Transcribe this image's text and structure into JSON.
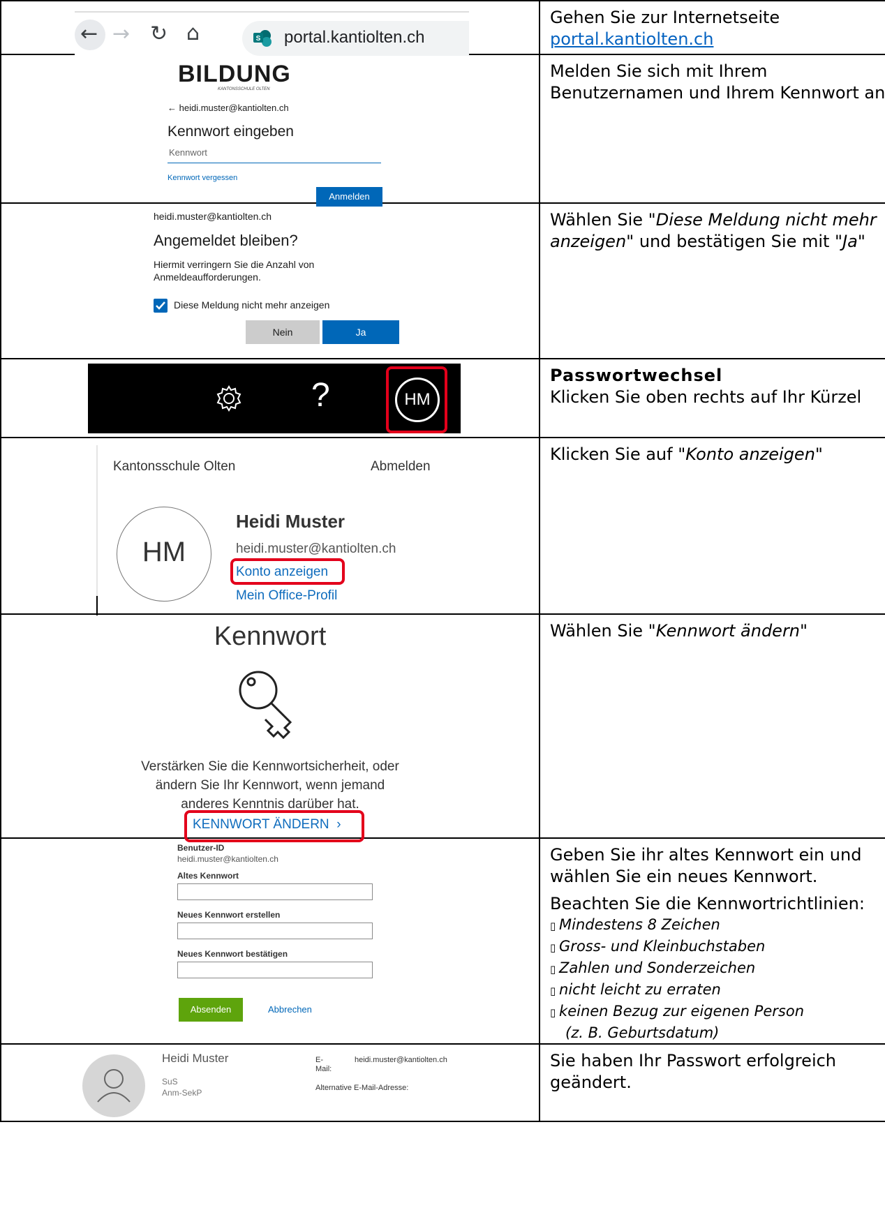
{
  "steps": {
    "s1": {
      "url": "portal.kantiolten.ch",
      "text": "Gehen Sie zur Internetseite",
      "link": "portal.kantiolten.ch"
    },
    "s2": {
      "logo": "BILDUNG",
      "logo_sub": "KANTONSSCHULE OLTEN",
      "back_email": "← heidi.muster@kantiolten.ch",
      "heading": "Kennwort eingeben",
      "field_placeholder": "Kennwort",
      "forgot": "Kennwort vergessen",
      "button": "Anmelden",
      "text": "Melden Sie sich mit Ihrem Benutzernamen und Ihrem Kennwort an."
    },
    "s3": {
      "email": "heidi.muster@kantiolten.ch",
      "heading": "Angemeldet bleiben?",
      "desc1": "Hiermit verringern Sie die Anzahl von",
      "desc2": "Anmeldeaufforderungen.",
      "checkbox": "Diese Meldung nicht mehr anzeigen",
      "no": "Nein",
      "yes": "Ja",
      "text_a": "Wählen Sie \"",
      "text_b": "Diese Meldung nicht mehr anzeigen",
      "text_c": "\" und bestätigen Sie mit \"",
      "text_d": "Ja",
      "text_e": "\""
    },
    "s4": {
      "help": "?",
      "initials": "HM",
      "title": "Passwortwechsel",
      "text": "Klicken Sie oben rechts auf Ihr Kürzel"
    },
    "s5": {
      "org": "Kantonsschule Olten",
      "signout": "Abmelden",
      "initials": "HM",
      "name": "Heidi Muster",
      "email": "heidi.muster@kantiolten.ch",
      "account": "Konto anzeigen",
      "office": "Mein Office-Profil",
      "text_a": "Klicken Sie auf \"",
      "text_b": "Konto anzeigen",
      "text_c": "\""
    },
    "s6": {
      "heading": "Kennwort",
      "desc1": "Verstärken Sie die Kennwortsicherheit, oder",
      "desc2": "ändern Sie Ihr Kennwort, wenn jemand",
      "desc3": "anderes Kenntnis darüber hat.",
      "link": "KENNWORT ÄNDERN",
      "text_a": "Wählen Sie \"",
      "text_b": "Kennwort ändern",
      "text_c": "\""
    },
    "s7": {
      "uid_label": "Benutzer-ID",
      "uid": "heidi.muster@kantiolten.ch",
      "old_label": "Altes Kennwort",
      "new_label": "Neues Kennwort erstellen",
      "confirm_label": "Neues Kennwort bestätigen",
      "submit": "Absenden",
      "cancel": "Abbrechen",
      "text1": "Geben Sie ihr altes Kennwort ein und wählen Sie ein neues Kennwort.",
      "text2": "Beachten Sie die Kennwortrichtlinien:",
      "rules": [
        "Mindestens 8 Zeichen",
        "Gross- und Kleinbuchstaben",
        "Zahlen und Sonderzeichen",
        "nicht leicht zu erraten",
        "keinen Bezug zur eigenen Person",
        "(z. B. Geburtsdatum)"
      ],
      "bullet_glyph": "▯"
    },
    "s8": {
      "name": "Heidi Muster",
      "role": "SuS",
      "dept": "Anm-SekP",
      "email_label1": "E-",
      "email_label2": "Mail:",
      "email": "heidi.muster@kantiolten.ch",
      "alt_label": "Alternative E-Mail-Adresse:",
      "text": "Sie haben Ihr Passwort erfolgreich geändert."
    }
  }
}
